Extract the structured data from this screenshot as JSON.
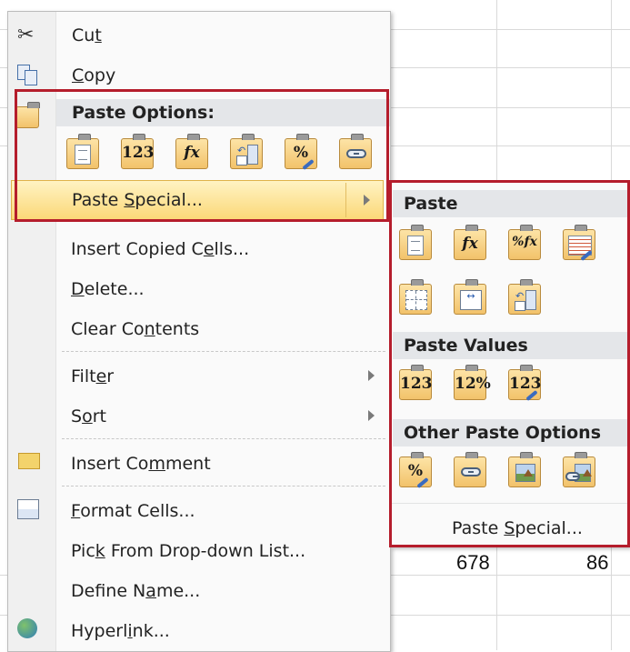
{
  "sheet": {
    "visible_values": [
      "678",
      "86"
    ]
  },
  "context_menu": {
    "items": [
      {
        "label_pre": "Cu",
        "label_key": "t",
        "label_post": "",
        "icon": "scissors-icon"
      },
      {
        "label_pre": "",
        "label_key": "C",
        "label_post": "opy",
        "icon": "copy-icon"
      }
    ],
    "paste_options_header": "Paste Options:",
    "paste_options_icons": [
      "paste-icon",
      "paste-values-icon",
      "paste-formulas-icon",
      "paste-transpose-icon",
      "paste-formatting-icon",
      "paste-link-icon"
    ],
    "paste_options_glyphs": {
      "values": "123",
      "formulas": "fx",
      "formatting": "%"
    },
    "paste_special": {
      "pre": "Paste ",
      "key": "S",
      "post": "pecial..."
    },
    "insert_copied": {
      "pre": "Insert Copied C",
      "key": "e",
      "post": "lls..."
    },
    "delete": {
      "pre": "",
      "key": "D",
      "post": "elete..."
    },
    "clear_contents": {
      "pre": "Clear Co",
      "key": "n",
      "post": "tents"
    },
    "filter": {
      "pre": "Filt",
      "key": "e",
      "post": "r"
    },
    "sort": {
      "pre": "S",
      "key": "o",
      "post": "rt"
    },
    "insert_comment": {
      "pre": "Insert Co",
      "key": "m",
      "post": "ment"
    },
    "format_cells": {
      "pre": "",
      "key": "F",
      "post": "ormat Cells..."
    },
    "pick_list": {
      "pre": "Pic",
      "key": "k",
      "post": " From Drop-down List..."
    },
    "define_name": {
      "pre": "Define N",
      "key": "a",
      "post": "me..."
    },
    "hyperlink": {
      "pre": "Hyperl",
      "key": "i",
      "post": "nk..."
    }
  },
  "submenu": {
    "paste_header": "Paste",
    "paste_values_header": "Paste Values",
    "other_header": "Other Paste Options",
    "glyphs": {
      "fx": "fx",
      "pct_fx": "%fx",
      "values": "123",
      "values_pct": "12%",
      "values_brush": "123",
      "pct": "%"
    },
    "footer": {
      "pre": "Paste ",
      "key": "S",
      "post": "pecial..."
    }
  },
  "colors": {
    "highlight_frame": "#b51d2c",
    "hover_fill": "#fbd878",
    "header_fill": "#e4e6e9"
  }
}
